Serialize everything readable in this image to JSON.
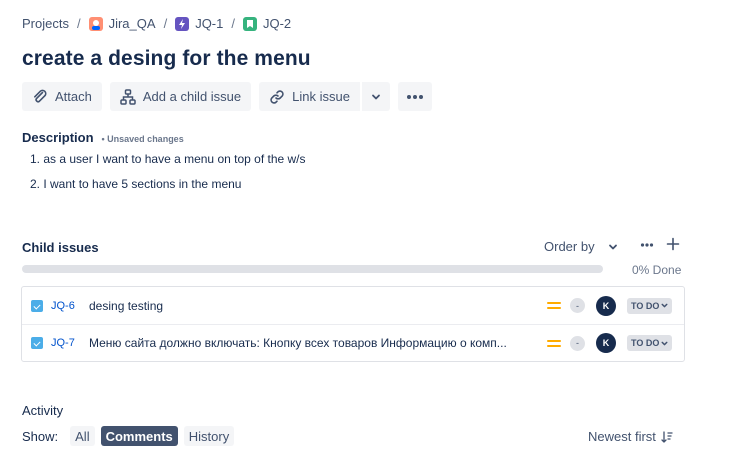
{
  "breadcrumb": {
    "projects": "Projects",
    "project": "Jira_QA",
    "epic": "JQ-1",
    "story": "JQ-2"
  },
  "issue": {
    "title": "create a desing for the menu"
  },
  "toolbar": {
    "attach": "Attach",
    "add_child": "Add a child issue",
    "link_issue": "Link issue"
  },
  "description": {
    "label": "Description",
    "unsaved": "• Unsaved changes",
    "items": [
      "1. as a user I want to have a menu on top of the w/s",
      "2. I want to have 5 sections in the menu"
    ]
  },
  "child_issues": {
    "label": "Child issues",
    "order_by": "Order by",
    "progress_percent": 0,
    "progress_label": "0% Done",
    "items": [
      {
        "key": "JQ-6",
        "summary": "desing testing",
        "estimate": "-",
        "assignee": "K",
        "status": "TO DO"
      },
      {
        "key": "JQ-7",
        "summary": "Меню сайта должно включать: Кнопку всех товаров Информацию о комп...",
        "estimate": "-",
        "assignee": "K",
        "status": "TO DO"
      }
    ]
  },
  "activity": {
    "label": "Activity",
    "show": "Show:",
    "filters": [
      "All",
      "Comments",
      "History"
    ],
    "active_filter": "Comments",
    "sort": "Newest first"
  },
  "colors": {
    "accent": "#0052cc",
    "priority_medium": "#ffab00",
    "epic": "#6554c0",
    "story": "#36b37e",
    "task": "#4bade8"
  }
}
